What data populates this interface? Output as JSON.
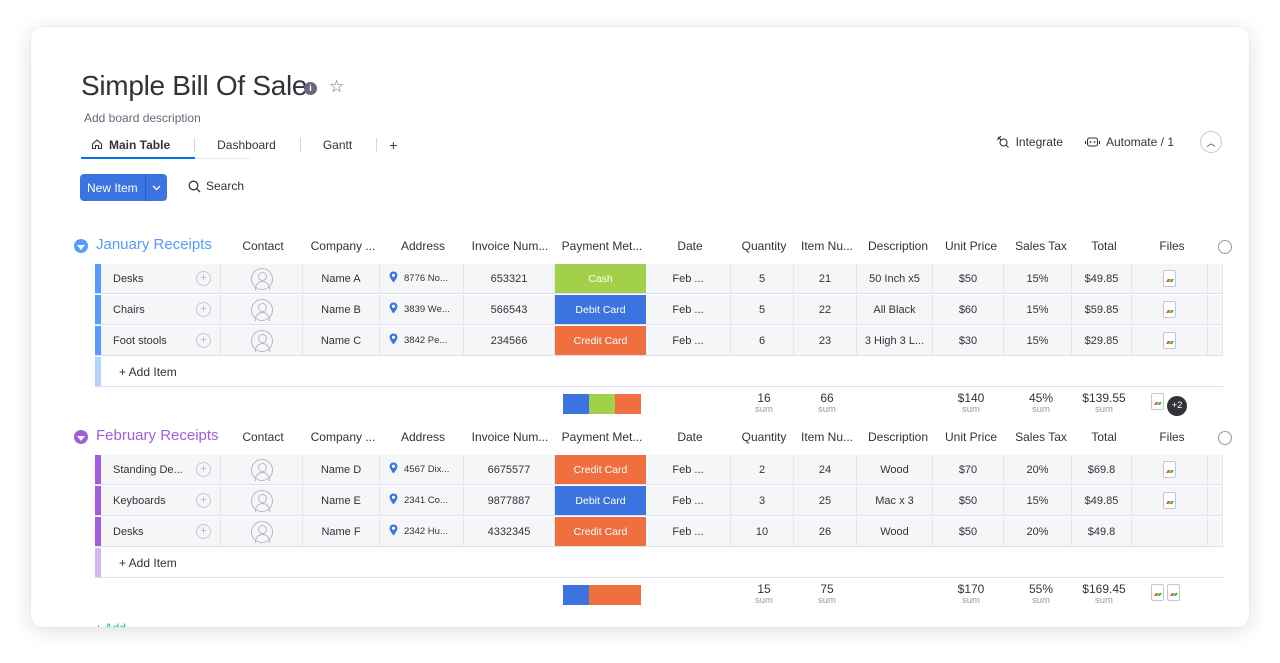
{
  "board": {
    "title": "Simple Bill Of Sale",
    "description": "Add board description"
  },
  "tabs": [
    {
      "label": "Main Table",
      "icon": "home-icon",
      "active": true
    },
    {
      "label": "Dashboard"
    },
    {
      "label": "Gantt"
    },
    {
      "label": "+"
    }
  ],
  "toolbar": {
    "integrate": "Integrate",
    "automate": "Automate / 1",
    "new_item": "New Item",
    "search": "Search"
  },
  "columns": [
    "Contact",
    "Company ...",
    "Address",
    "Invoice Num...",
    "Payment Met...",
    "Date",
    "Quantity",
    "Item Nu...",
    "Description",
    "Unit Price",
    "Sales Tax",
    "Total",
    "Files"
  ],
  "colors": {
    "cash": "#a2d149",
    "debit": "#3b73e0",
    "credit": "#ef6f3e",
    "january": "#579bfc",
    "february": "#a25ddc"
  },
  "groups": [
    {
      "title": "January Receipts",
      "color": "#579bfc",
      "add_item": "+ Add Item",
      "rows": [
        {
          "item": "Desks",
          "company": "Name A",
          "address": "8776 No...",
          "invoice": "653321",
          "payment": "Cash",
          "date": "Feb ...",
          "quantity": "5",
          "item_num": "21",
          "description": "50 Inch x5",
          "unit_price": "$50",
          "sales_tax": "15%",
          "total": "$49.85",
          "files": 1
        },
        {
          "item": "Chairs",
          "company": "Name B",
          "address": "3839 We...",
          "invoice": "566543",
          "payment": "Debit Card",
          "date": "Feb ...",
          "quantity": "5",
          "item_num": "22",
          "description": "All Black",
          "unit_price": "$60",
          "sales_tax": "15%",
          "total": "$59.85",
          "files": 1
        },
        {
          "item": "Foot stools",
          "company": "Name C",
          "address": "3842 Pe...",
          "invoice": "234566",
          "payment": "Credit Card",
          "date": "Feb ...",
          "quantity": "6",
          "item_num": "23",
          "description": "3 High 3 L...",
          "unit_price": "$30",
          "sales_tax": "15%",
          "total": "$29.85",
          "files": 1
        }
      ],
      "summary": {
        "payment_distribution": [
          {
            "method": "Debit Card",
            "share": 1
          },
          {
            "method": "Cash",
            "share": 1
          },
          {
            "method": "Credit Card",
            "share": 1
          }
        ],
        "quantity": "16",
        "item_num": "66",
        "unit_price": "$140",
        "sales_tax": "45%",
        "total": "$139.55",
        "sum_label": "sum",
        "files_extra": "+2"
      }
    },
    {
      "title": "February Receipts",
      "color": "#a25ddc",
      "add_item": "+ Add Item",
      "rows": [
        {
          "item": "Standing De...",
          "company": "Name D",
          "address": "4567 Dix...",
          "invoice": "6675577",
          "payment": "Credit Card",
          "date": "Feb ...",
          "quantity": "2",
          "item_num": "24",
          "description": "Wood",
          "unit_price": "$70",
          "sales_tax": "20%",
          "total": "$69.8",
          "files": 1
        },
        {
          "item": "Keyboards",
          "company": "Name E",
          "address": "2341 Co...",
          "invoice": "9877887",
          "payment": "Debit Card",
          "date": "Feb ...",
          "quantity": "3",
          "item_num": "25",
          "description": "Mac x 3",
          "unit_price": "$50",
          "sales_tax": "15%",
          "total": "$49.85",
          "files": 1
        },
        {
          "item": "Desks",
          "company": "Name F",
          "address": "2342 Hu...",
          "invoice": "4332345",
          "payment": "Credit Card",
          "date": "Feb ...",
          "quantity": "10",
          "item_num": "26",
          "description": "Wood",
          "unit_price": "$50",
          "sales_tax": "20%",
          "total": "$49.8",
          "files": 0
        }
      ],
      "summary": {
        "payment_distribution": [
          {
            "method": "Debit Card",
            "share": 1
          },
          {
            "method": "Credit Card",
            "share": 2
          }
        ],
        "quantity": "15",
        "item_num": "75",
        "unit_price": "$170",
        "sales_tax": "55%",
        "total": "$169.45",
        "sum_label": "sum",
        "files_count": 2
      }
    }
  ],
  "footer": {
    "add_group": "+ Add..."
  }
}
